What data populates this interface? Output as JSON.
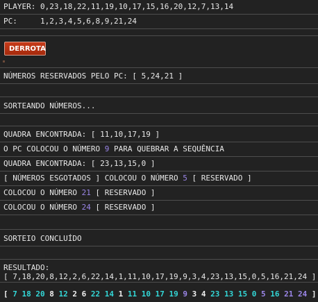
{
  "header": {
    "player_line": "PLAYER: 0,23,18,22,11,19,10,17,15,16,20,12,7,13,14",
    "pc_line": "PC:     1,2,3,4,5,6,8,9,21,24"
  },
  "button": {
    "label": "DERROTA"
  },
  "log": {
    "reserved_pc": "NÚMEROS RESERVADOS PELO PC: [ 5,24,21 ]",
    "drawing": "SORTEANDO NÚMEROS...",
    "quad1": "QUADRA ENCONTRADA: [ 11,10,17,19 ]",
    "placed_prefix": "O PC COLOCOU O NÚMERO ",
    "placed_number": "9",
    "placed_suffix": " PARA QUEBRAR A SEQUÊNCIA",
    "quad2": "QUADRA ENCONTRADA: [ 23,13,15,0 ]",
    "exhausted_prefix": "[ NÚMEROS ESGOTADOS ] COLOCOU O NÚMERO ",
    "exhausted_number": "5",
    "reserved_tag": " [ RESERVADO ]",
    "placed2_prefix": "COLOCOU O NÚMERO ",
    "placed2_number": "21",
    "placed3_prefix": "COLOCOU O NÚMERO ",
    "placed3_number": "24",
    "done": "SORTEIO CONCLUÍDO"
  },
  "result": {
    "label": "RESULTADO:",
    "sequence_text": "[ 7,18,20,8,12,2,6,22,14,1,11,10,17,19,9,3,4,23,13,15,0,5,16,21,24 ]",
    "open_bracket": "[",
    "close_bracket": "]",
    "colored_sequence": [
      {
        "value": "7",
        "color": "cyan"
      },
      {
        "value": "18",
        "color": "cyan"
      },
      {
        "value": "20",
        "color": "cyan"
      },
      {
        "value": "8",
        "color": "white"
      },
      {
        "value": "12",
        "color": "cyan"
      },
      {
        "value": "2",
        "color": "white"
      },
      {
        "value": "6",
        "color": "white"
      },
      {
        "value": "22",
        "color": "cyan"
      },
      {
        "value": "14",
        "color": "cyan"
      },
      {
        "value": "1",
        "color": "white"
      },
      {
        "value": "11",
        "color": "cyan"
      },
      {
        "value": "10",
        "color": "cyan"
      },
      {
        "value": "17",
        "color": "cyan"
      },
      {
        "value": "19",
        "color": "cyan"
      },
      {
        "value": "9",
        "color": "purple"
      },
      {
        "value": "3",
        "color": "white"
      },
      {
        "value": "4",
        "color": "white"
      },
      {
        "value": "23",
        "color": "cyan"
      },
      {
        "value": "13",
        "color": "cyan"
      },
      {
        "value": "15",
        "color": "cyan"
      },
      {
        "value": "0",
        "color": "cyan"
      },
      {
        "value": "5",
        "color": "purple"
      },
      {
        "value": "16",
        "color": "cyan"
      },
      {
        "value": "21",
        "color": "purple"
      },
      {
        "value": "24",
        "color": "purple"
      }
    ]
  },
  "colors": {
    "background": "#222222",
    "text": "#e8e8e8",
    "separator": "#4e4e4e",
    "purple": "#9b86e8",
    "cyan": "#33d6d6",
    "button": "#b8300f"
  }
}
